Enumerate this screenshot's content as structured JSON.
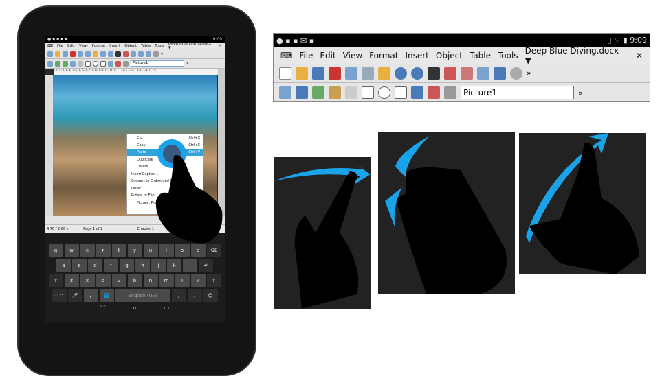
{
  "status": {
    "time": "9:09"
  },
  "menu": [
    "File",
    "Edit",
    "View",
    "Format",
    "Insert",
    "Object",
    "Table",
    "Tools"
  ],
  "doc_title": "Deep Blue Diving.docx ▼",
  "close": "✕",
  "object_name": "Picture1",
  "more": "»",
  "ruler": "·2·1·3·1·4·1·5·1·6·1·7·1·8·1·9·1·10·1·11·1·12·1·13·1·14·1·15",
  "context_menu": [
    {
      "label": "Cut",
      "shortcut": "Ctrl+X"
    },
    {
      "label": "Copy",
      "shortcut": "Ctrl+C"
    },
    {
      "label": "Paste",
      "shortcut": "Ctrl+V",
      "highlighted": true
    },
    {
      "label": "Duplicate",
      "shortcut": ""
    },
    {
      "label": "Delete",
      "shortcut": ""
    },
    {
      "label": "Insert Caption...",
      "shortcut": ""
    },
    {
      "label": "Convert to Embedded O...",
      "shortcut": ""
    },
    {
      "label": "Order",
      "shortcut": ""
    },
    {
      "label": "Rotate or Flip",
      "shortcut": ""
    },
    {
      "label": "Picture: Propert...",
      "shortcut": ""
    }
  ],
  "statusbar": {
    "size": "4.76 / 2.66 in",
    "page": "Page 1 of 2",
    "chapter": "Chapter 1",
    "lang": "En"
  },
  "keyboard": {
    "row1": [
      "q",
      "w",
      "e",
      "r",
      "t",
      "y",
      "u",
      "i",
      "o",
      "p",
      "⌫"
    ],
    "row2": [
      "a",
      "s",
      "d",
      "f",
      "g",
      "h",
      "j",
      "k",
      "l",
      "↵"
    ],
    "row3": [
      "⇧",
      "z",
      "x",
      "c",
      "v",
      "b",
      "n",
      "m",
      "!",
      "?",
      "⇧"
    ],
    "row4": [
      "?123",
      "🎤",
      "/",
      "🌐",
      "English (US)",
      ",",
      ".",
      "☺"
    ],
    "nav": [
      "﹀",
      "⌂",
      "▭"
    ]
  },
  "colors": {
    "accent": "#33a3dc",
    "gesture": "#1aa3e8"
  }
}
